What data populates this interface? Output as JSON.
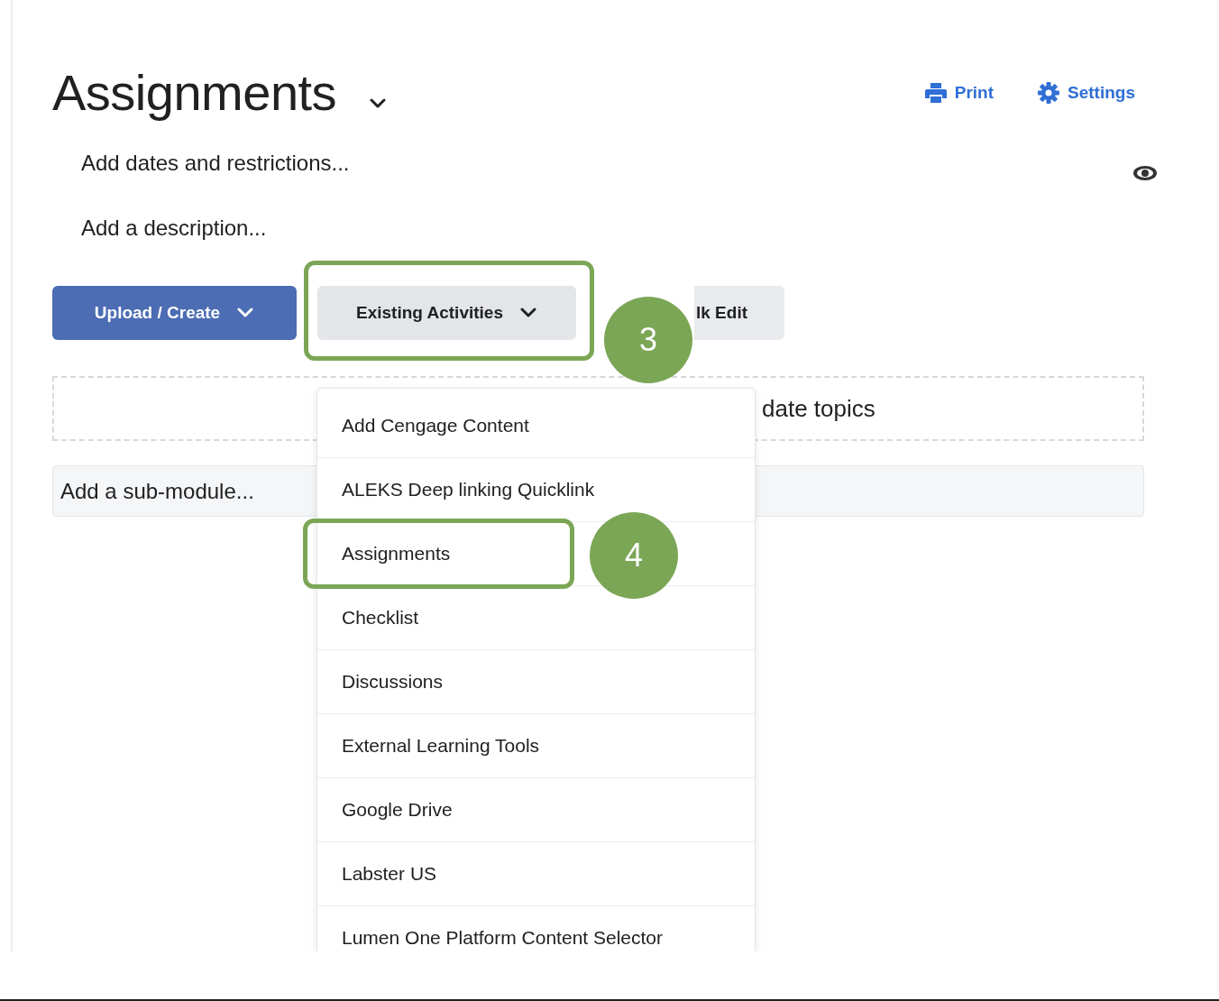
{
  "page": {
    "title": "Assignments",
    "actions": [
      {
        "kind": "print",
        "label": "Print"
      },
      {
        "kind": "settings",
        "label": "Settings"
      }
    ],
    "links": [
      "Add dates and restrictions...",
      "Add a description..."
    ],
    "buttons": [
      {
        "kind": "primary",
        "label": "Upload / Create",
        "highlighted": false
      },
      {
        "kind": "secondary",
        "label": "Existing Activities",
        "highlighted": true
      },
      {
        "kind": "plain",
        "label": "lk Edit",
        "highlighted": false
      }
    ],
    "drop_zone": {
      "text": "date topics"
    },
    "submodule": {
      "placeholder": "Add a sub-module..."
    }
  },
  "menu": {
    "items": [
      {
        "label": "Add Cengage Content",
        "highlighted": false
      },
      {
        "label": "ALEKS Deep linking Quicklink",
        "highlighted": false
      },
      {
        "label": "Assignments",
        "highlighted": true
      },
      {
        "label": "Checklist",
        "highlighted": false
      },
      {
        "label": "Discussions",
        "highlighted": false
      },
      {
        "label": "External Learning Tools",
        "highlighted": false
      },
      {
        "label": "Google Drive",
        "highlighted": false
      },
      {
        "label": "Labster US",
        "highlighted": false
      },
      {
        "label": "Lumen One Platform Content Selector",
        "highlighted": false
      }
    ]
  },
  "callouts": [
    {
      "number": "3"
    },
    {
      "number": "4"
    }
  ]
}
